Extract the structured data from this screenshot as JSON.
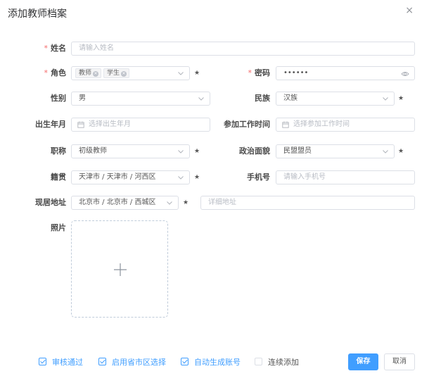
{
  "dialog": {
    "title": "添加教师档案",
    "close_glyph": "×"
  },
  "form": {
    "name": {
      "label": "姓名",
      "placeholder": "请输入姓名"
    },
    "role": {
      "label": "角色",
      "tags": [
        "教师",
        "学生"
      ]
    },
    "password": {
      "label": "密码",
      "value": "••••••"
    },
    "gender": {
      "label": "性别",
      "value": "男"
    },
    "ethnicity": {
      "label": "民族",
      "value": "汉族"
    },
    "birth": {
      "label": "出生年月",
      "placeholder": "选择出生年月"
    },
    "work_start": {
      "label": "参加工作时间",
      "placeholder": "选择参加工作时间"
    },
    "title": {
      "label": "职称",
      "value": "初级教师"
    },
    "political": {
      "label": "政治面貌",
      "value": "民盟盟员"
    },
    "native": {
      "label": "籍贯",
      "value": "天津市 / 天津市 / 河西区"
    },
    "phone": {
      "label": "手机号",
      "placeholder": "请输入手机号"
    },
    "address": {
      "label": "现居地址",
      "value": "北京市 / 北京市 / 西城区",
      "detail_placeholder": "详细地址"
    },
    "photo": {
      "label": "照片"
    },
    "required_mark": "*",
    "star_mark": "★"
  },
  "footer": {
    "checkboxes": [
      {
        "label": "审核通过",
        "checked": true
      },
      {
        "label": "启用省市区选择",
        "checked": true
      },
      {
        "label": "自动生成账号",
        "checked": true
      },
      {
        "label": "连续添加",
        "checked": false
      }
    ],
    "save_label": "保存",
    "cancel_label": "取消"
  },
  "colors": {
    "primary": "#409eff",
    "required": "#f56c6c"
  }
}
